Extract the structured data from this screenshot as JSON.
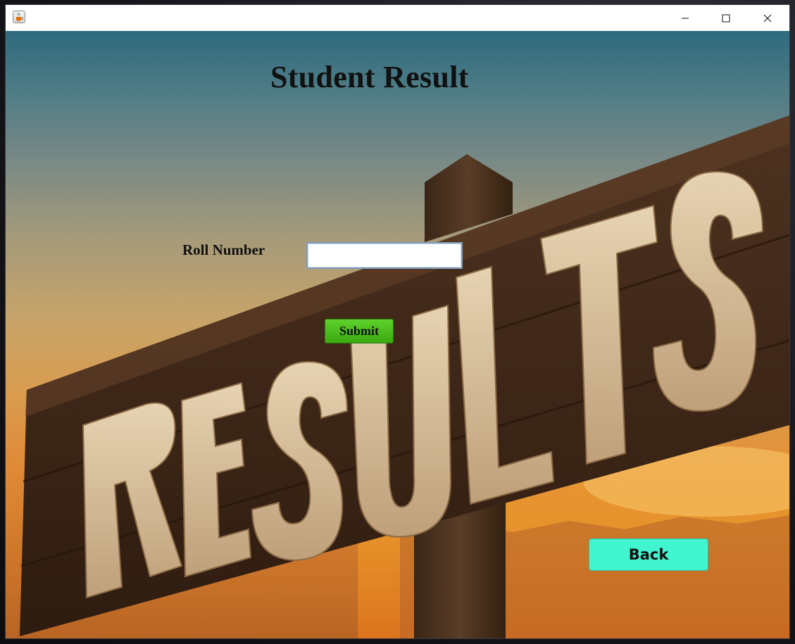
{
  "window": {
    "title": "",
    "icon": "java-cup-icon",
    "controls": [
      "minimize-icon",
      "maximize-icon",
      "close-icon"
    ]
  },
  "page": {
    "heading": "Student Result"
  },
  "form": {
    "roll_label": "Roll Number",
    "roll_value": "",
    "submit_label": "Submit"
  },
  "navigation": {
    "back_label": "Back"
  },
  "background": {
    "image_text": "RESULTS"
  },
  "colors": {
    "submit_button": "#4cc21c",
    "back_button": "#40f5cf",
    "input_border": "#7f9db9"
  }
}
